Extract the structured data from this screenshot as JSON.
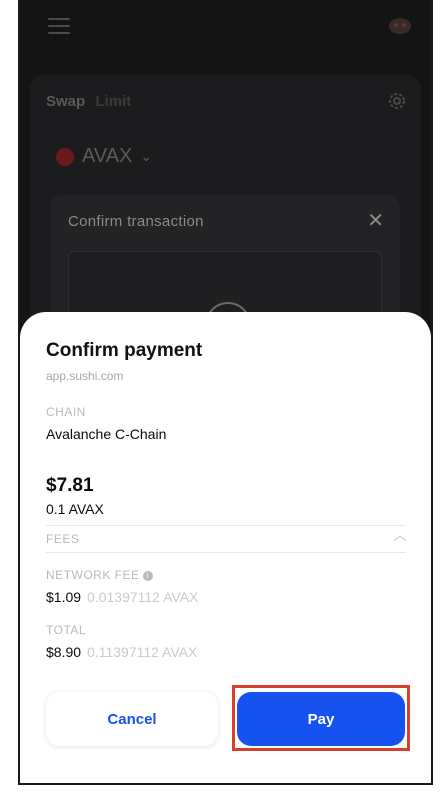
{
  "background_app": {
    "tabs": [
      "Swap",
      "Limit"
    ],
    "token": "AVAX",
    "modal_title": "Confirm transaction"
  },
  "sheet": {
    "title": "Confirm payment",
    "site": "app.sushi.com",
    "chain_label": "CHAIN",
    "chain_value": "Avalanche C-Chain",
    "amount_usd": "$7.81",
    "amount_token": "0.1 AVAX",
    "fees_label": "FEES",
    "network_fee_label": "NETWORK FEE",
    "network_fee_usd": "$1.09",
    "network_fee_token": "0.01397112 AVAX",
    "total_label": "TOTAL",
    "total_usd": "$8.90",
    "total_token": "0.11397112 AVAX"
  },
  "buttons": {
    "cancel": "Cancel",
    "pay": "Pay"
  },
  "colors": {
    "accent": "#1652f0",
    "highlight": "#d9402c"
  }
}
